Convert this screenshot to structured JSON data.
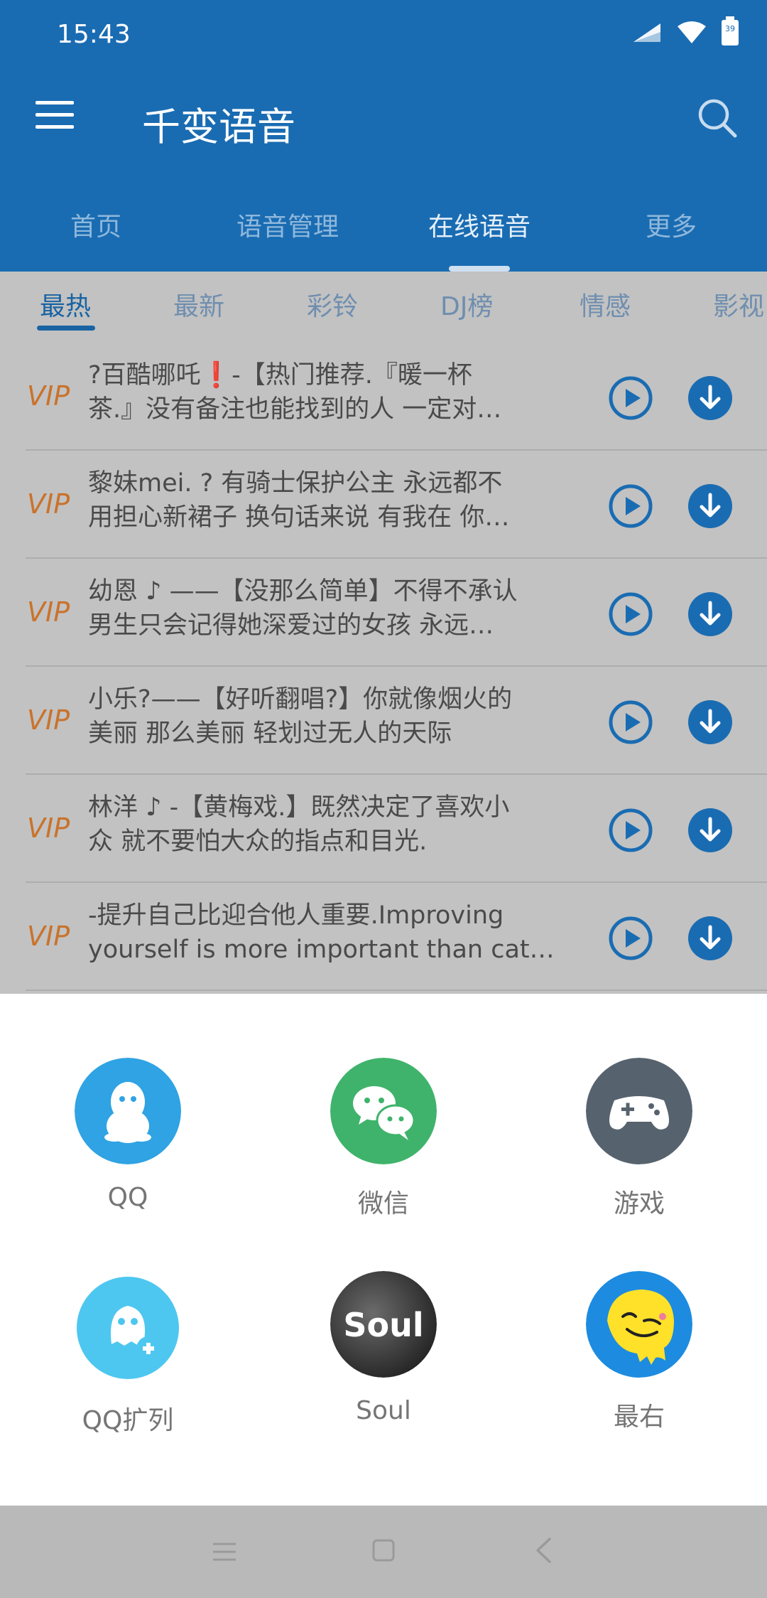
{
  "status_bar": {
    "time": "15:43",
    "battery": "39"
  },
  "app": {
    "title": "千变语音"
  },
  "tabs": [
    {
      "label": "首页"
    },
    {
      "label": "语音管理"
    },
    {
      "label": "在线语音"
    },
    {
      "label": "更多"
    }
  ],
  "subtabs": [
    {
      "label": "最热"
    },
    {
      "label": "最新"
    },
    {
      "label": "彩铃"
    },
    {
      "label": "DJ榜"
    },
    {
      "label": "情感"
    },
    {
      "label": "影视"
    }
  ],
  "voice_list": [
    {
      "line1": "?百酷哪吒❗-【热门推荐.『暖一杯",
      "line2": "茶.』没有备注也能找到的人 一定对…",
      "badge": "VIP"
    },
    {
      "line1": "黎妹mei. ? 有骑士保护公主 永远都不",
      "line2": "用担心新裙子 换句话来说 有我在 你…",
      "badge": "VIP"
    },
    {
      "line1": "幼恩 ♪ ——【没那么简单】不得不承认",
      "line2": "男生只会记得她深爱过的女孩 永远…",
      "badge": "VIP"
    },
    {
      "line1": "小乐?——【好听翻唱?】你就像烟火的",
      "line2": "美丽 那么美丽 轻划过无人的天际",
      "badge": "VIP"
    },
    {
      "line1": "林洋 ♪ -【黄梅戏.】既然决定了喜欢小",
      "line2": "众 就不要怕大众的指点和目光.",
      "badge": "VIP"
    },
    {
      "line1": "-提升自己比迎合他人重要.Improving",
      "line2": "yourself is more important than cat…",
      "badge": "VIP"
    }
  ],
  "share_sheet": {
    "items": [
      {
        "label": "QQ",
        "icon": "qq-icon",
        "color": "#2fa3e3"
      },
      {
        "label": "微信",
        "icon": "wechat-icon",
        "color": "#3fb36b"
      },
      {
        "label": "游戏",
        "icon": "gamepad-icon",
        "color": "#56636e"
      },
      {
        "label": "QQ扩列",
        "icon": "qq-kuolie-icon",
        "color": "#4dc7f0"
      },
      {
        "label": "Soul",
        "icon": "soul-icon",
        "color": "#2b2b2b"
      },
      {
        "label": "最右",
        "icon": "zuiyou-icon",
        "color": "#1d8be0"
      }
    ],
    "soul_logo_text": "Soul"
  },
  "colors": {
    "primary": "#1a6cb2",
    "vip": "#e07b22",
    "accent_blue": "#1a6cb2"
  }
}
